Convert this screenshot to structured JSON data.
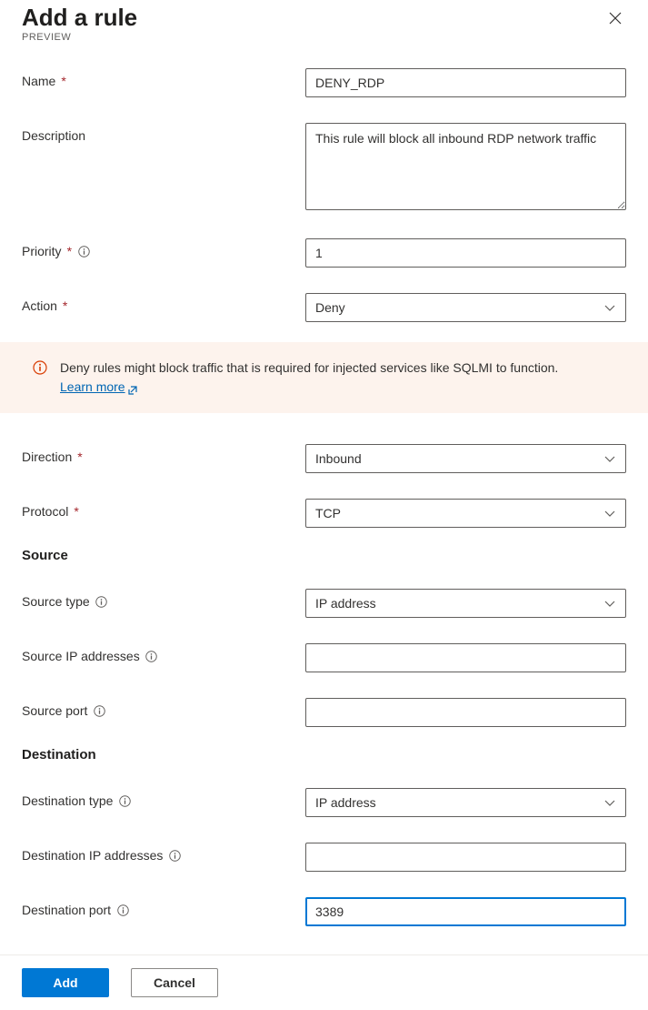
{
  "header": {
    "title": "Add a rule",
    "subtitle": "PREVIEW"
  },
  "labels": {
    "name": "Name",
    "description": "Description",
    "priority": "Priority",
    "action": "Action",
    "direction": "Direction",
    "protocol": "Protocol",
    "source_heading": "Source",
    "source_type": "Source type",
    "source_ip": "Source IP addresses",
    "source_port": "Source port",
    "dest_heading": "Destination",
    "dest_type": "Destination type",
    "dest_ip": "Destination IP addresses",
    "dest_port": "Destination port"
  },
  "values": {
    "name": "DENY_RDP",
    "description": "This rule will block all inbound RDP network traffic",
    "priority": "1",
    "action": "Deny",
    "direction": "Inbound",
    "protocol": "TCP",
    "source_type": "IP address",
    "source_ip": "",
    "source_port": "",
    "dest_type": "IP address",
    "dest_ip": "",
    "dest_port": "3389"
  },
  "warning": {
    "text_prefix": "Deny rules might block traffic that is required for injected services like SQLMI to function. ",
    "link_text": "Learn more"
  },
  "footer": {
    "add": "Add",
    "cancel": "Cancel"
  }
}
